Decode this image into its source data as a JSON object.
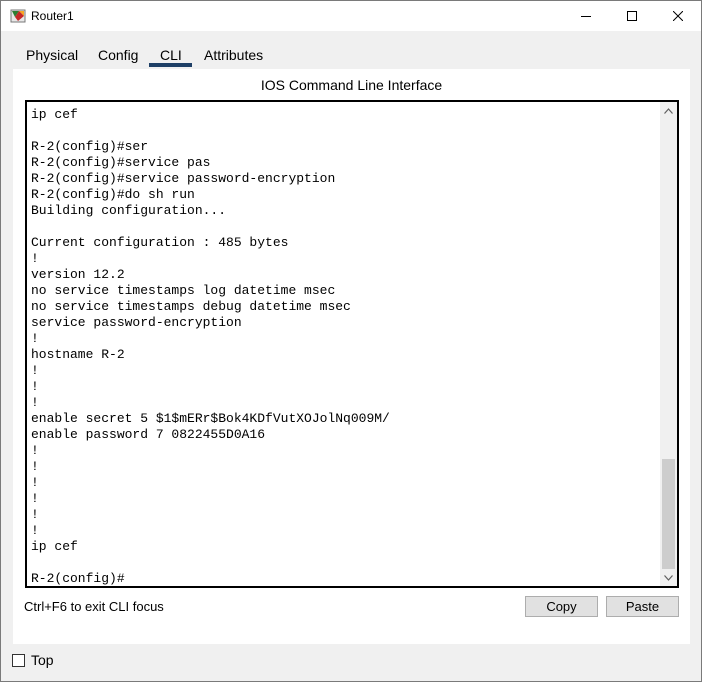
{
  "window": {
    "title": "Router1",
    "icon": "router-app-icon",
    "controls": [
      "minimize-icon",
      "maximize-icon",
      "close-icon"
    ]
  },
  "tabs": [
    {
      "label": "Physical"
    },
    {
      "label": "Config"
    },
    {
      "label": "CLI",
      "active": true
    },
    {
      "label": "Attributes"
    }
  ],
  "cli": {
    "heading": "IOS Command Line Interface",
    "lines": [
      "ip cef",
      "",
      "R-2(config)#ser",
      "R-2(config)#service pas",
      "R-2(config)#service password-encryption",
      "R-2(config)#do sh run",
      "Building configuration...",
      "",
      "Current configuration : 485 bytes",
      "!",
      "version 12.2",
      "no service timestamps log datetime msec",
      "no service timestamps debug datetime msec",
      "service password-encryption",
      "!",
      "hostname R-2",
      "!",
      "!",
      "!",
      "enable secret 5 $1$mERr$Bok4KDfVutXOJolNq009M/",
      "enable password 7 0822455D0A16",
      "!",
      "!",
      "!",
      "!",
      "!",
      "!",
      "ip cef",
      "",
      "R-2(config)#"
    ],
    "scroll_position_fraction": 0.78
  },
  "footer": {
    "hint": "Ctrl+F6 to exit CLI focus",
    "copy_label": "Copy",
    "paste_label": "Paste"
  },
  "top_checkbox": {
    "label": "Top",
    "checked": false
  },
  "colors": {
    "tab_underline": "#1e3f66",
    "window_bg": "#f0f0f0",
    "terminal_border": "#000000"
  }
}
